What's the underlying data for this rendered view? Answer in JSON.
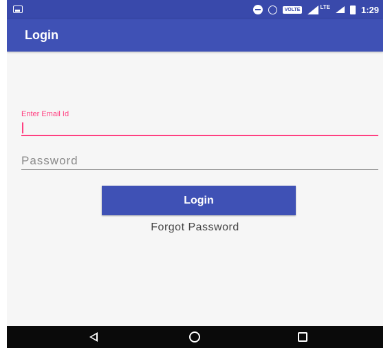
{
  "status_bar": {
    "time": "1:29",
    "volte_badge": "VOLTE",
    "network_label": "LTE"
  },
  "app_bar": {
    "title": "Login"
  },
  "form": {
    "email_label": "Enter Email Id",
    "email_value": "",
    "password_placeholder": "Password",
    "login_button_label": "Login",
    "forgot_password_label": "Forgot Password"
  },
  "colors": {
    "primary": "#3f51b5",
    "primary_dark": "#3949ab",
    "accent": "#ff4081"
  },
  "nav_bar": {
    "buttons": [
      "back-icon",
      "home-icon",
      "recents-icon"
    ]
  }
}
